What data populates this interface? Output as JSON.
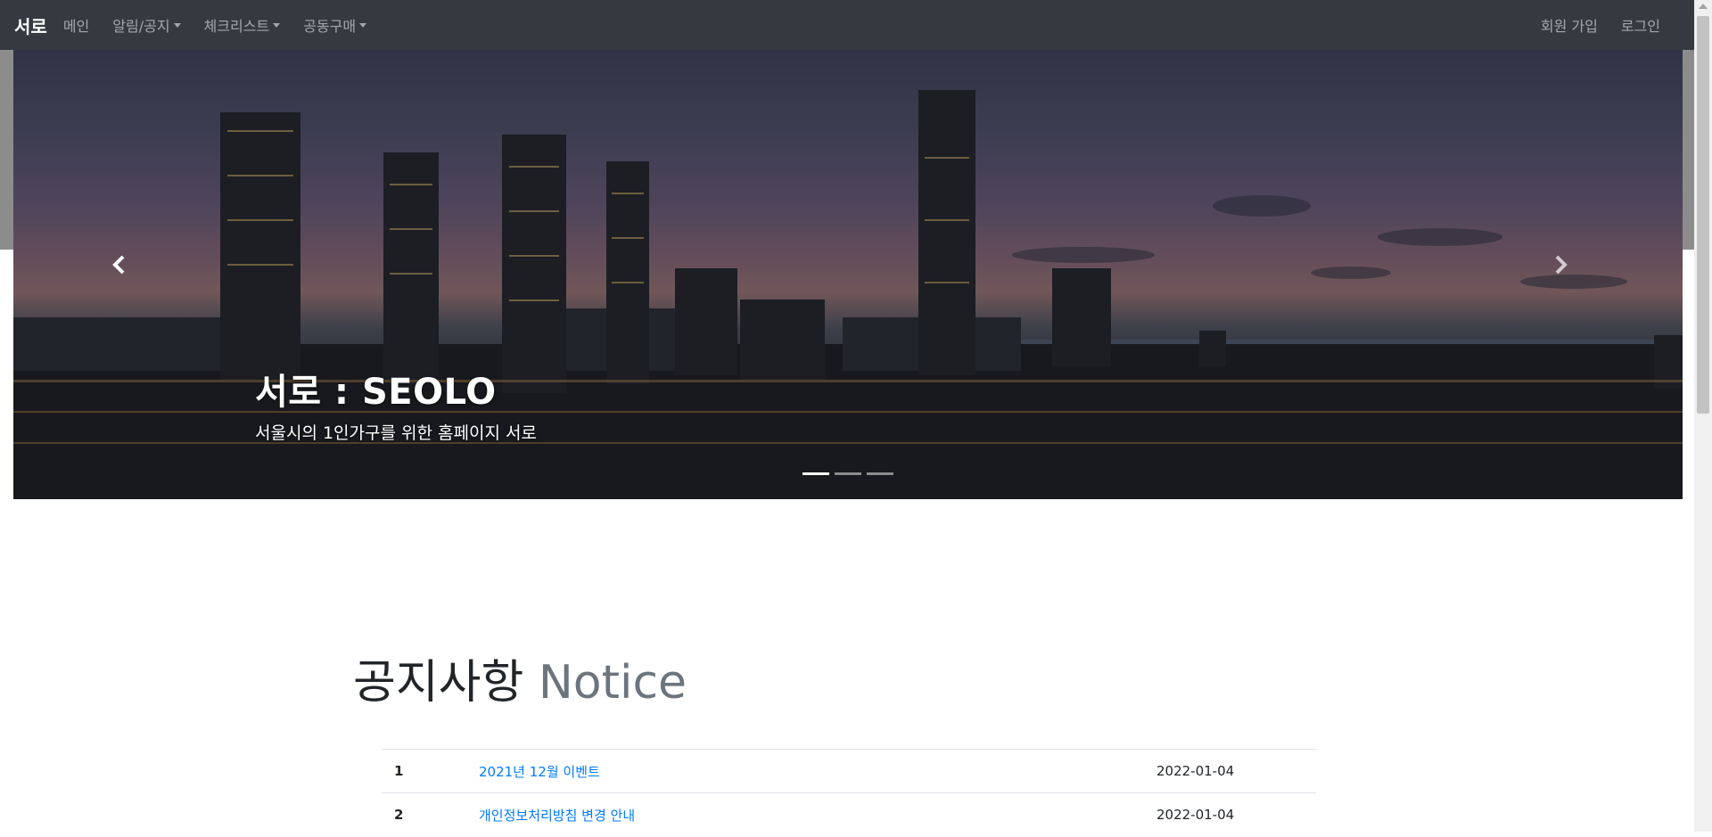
{
  "navbar": {
    "brand": "서로",
    "items": [
      {
        "label": "메인",
        "dropdown": false
      },
      {
        "label": "알림/공지",
        "dropdown": true
      },
      {
        "label": "체크리스트",
        "dropdown": true
      },
      {
        "label": "공동구매",
        "dropdown": true
      }
    ],
    "right_items": [
      {
        "label": "회원 가입"
      },
      {
        "label": "로그인"
      }
    ]
  },
  "carousel": {
    "title": "서로 : SEOLO",
    "subtitle": "서울시의 1인가구를 위한 홈페이지 서로",
    "prev_icon": "chevron-left-icon",
    "next_icon": "chevron-right-icon",
    "slide_count": 3,
    "active_slide": 1
  },
  "notice": {
    "heading_main": "공지사항",
    "heading_muted": "Notice",
    "rows": [
      {
        "num": "1",
        "title": "2021년 12월 이벤트",
        "date": "2022-01-04"
      },
      {
        "num": "2",
        "title": "개인정보처리방침 변경 안내",
        "date": "2022-01-04"
      }
    ]
  },
  "colors": {
    "navbar_bg": "#343a40",
    "link": "#007bff",
    "muted": "#6c757d"
  }
}
